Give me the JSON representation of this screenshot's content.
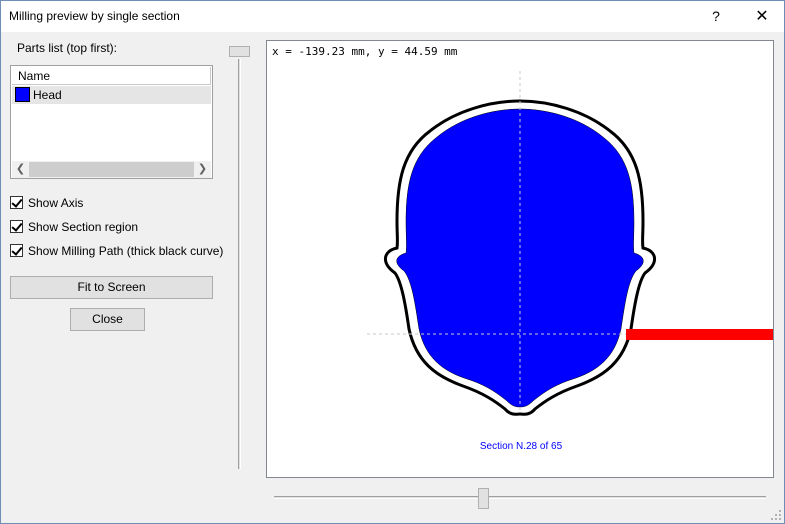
{
  "window": {
    "title": "Milling preview by single section",
    "help_label": "?",
    "close_label": "✕"
  },
  "parts": {
    "label": "Parts list (top first):",
    "column_header": "Name",
    "items": [
      {
        "name": "Head",
        "color": "#0000ff"
      }
    ]
  },
  "options": {
    "show_axis": {
      "label": "Show Axis",
      "checked": true
    },
    "show_section_region": {
      "label": "Show Section region",
      "checked": true
    },
    "show_milling_path": {
      "label": "Show Milling Path (thick black curve)",
      "checked": true
    }
  },
  "buttons": {
    "fit_to_screen": "Fit to Screen",
    "close": "Close"
  },
  "preview": {
    "coordinates": "x = -139.23 mm, y = 44.59 mm",
    "section_label": "Section N.28 of 65",
    "section_number": 28,
    "section_total": 65,
    "section_color": "#0000ff",
    "path_color": "#000000",
    "tool_color": "#ff0000"
  },
  "icons": {
    "scroll_left": "chevron-left-icon",
    "scroll_right": "chevron-right-icon"
  }
}
